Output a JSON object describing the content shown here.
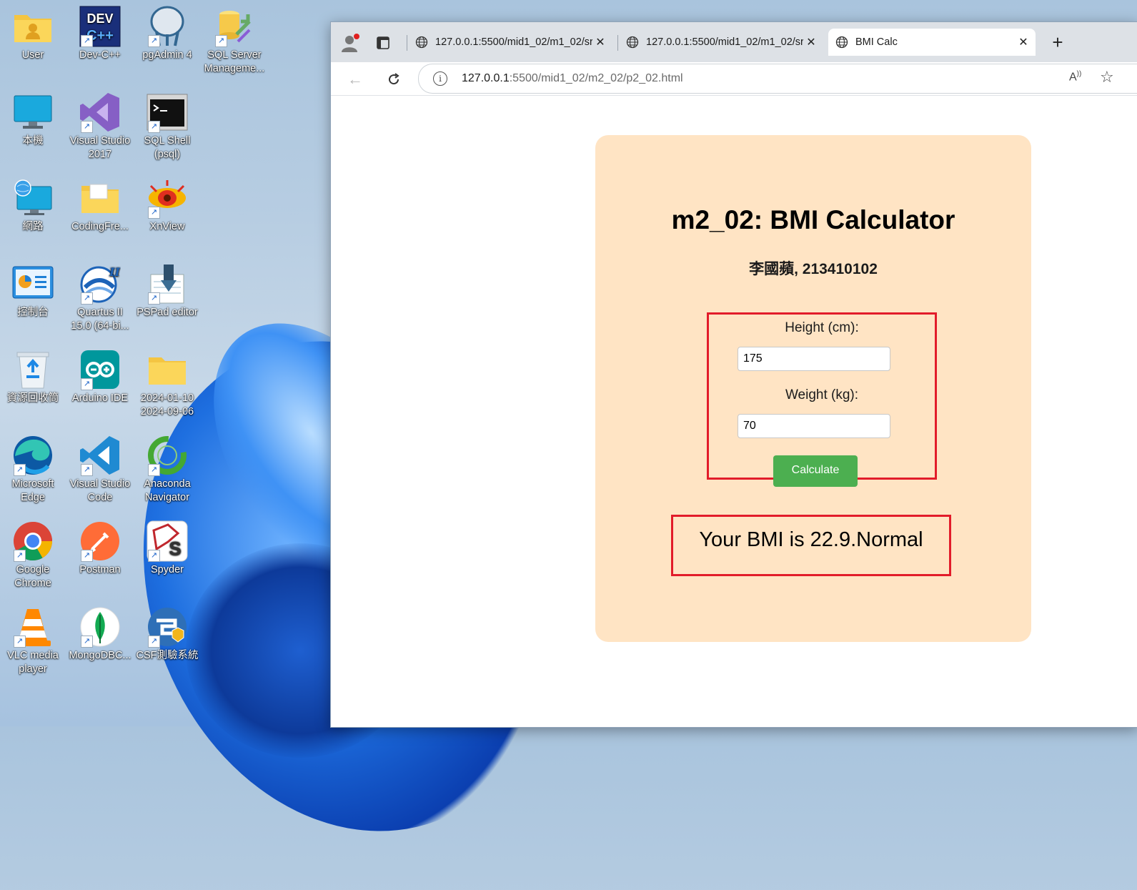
{
  "desktop": {
    "icons": [
      {
        "label": "User",
        "icon": "user-folder-icon"
      },
      {
        "label": "Dev-C++",
        "icon": "devcpp-icon"
      },
      {
        "label": "pgAdmin 4",
        "icon": "pgadmin-icon"
      },
      {
        "label": "SQL Server Manageme...",
        "icon": "sql-server-icon"
      },
      {
        "label": "本機",
        "icon": "monitor-icon"
      },
      {
        "label": "Visual Studio 2017",
        "icon": "visual-studio-icon"
      },
      {
        "label": "SQL Shell (psql)",
        "icon": "terminal-icon"
      },
      {
        "label": "網路",
        "icon": "network-icon"
      },
      {
        "label": "CodingFre...",
        "icon": "folder-icon"
      },
      {
        "label": "XnView",
        "icon": "xnview-icon"
      },
      {
        "label": "控制台",
        "icon": "control-panel-icon"
      },
      {
        "label": "Quartus II 15.0 (64-bi...",
        "icon": "quartus-icon"
      },
      {
        "label": "PSPad editor",
        "icon": "pspad-icon"
      },
      {
        "label": "資源回收筒",
        "icon": "recycle-bin-icon"
      },
      {
        "label": "Arduino IDE",
        "icon": "arduino-icon"
      },
      {
        "label": "2024-01-10 2024-09-06",
        "icon": "folder-icon"
      },
      {
        "label": "Microsoft Edge",
        "icon": "edge-icon"
      },
      {
        "label": "Visual Studio Code",
        "icon": "vscode-icon"
      },
      {
        "label": "Anaconda Navigator",
        "icon": "anaconda-icon"
      },
      {
        "label": "Google Chrome",
        "icon": "chrome-icon"
      },
      {
        "label": "Postman",
        "icon": "postman-icon"
      },
      {
        "label": "Spyder",
        "icon": "spyder-icon"
      },
      {
        "label": "VLC media player",
        "icon": "vlc-icon"
      },
      {
        "label": "MongoDBC...",
        "icon": "mongodb-icon"
      },
      {
        "label": "CSF測驗系統",
        "icon": "csf-icon"
      }
    ]
  },
  "browser": {
    "tabs": [
      {
        "title": "127.0.0.1:5500/mid1_02/m1_02/sr",
        "active": false
      },
      {
        "title": "127.0.0.1:5500/mid1_02/m1_02/sr",
        "active": false
      },
      {
        "title": "BMI Calc",
        "active": true
      }
    ],
    "url_host": "127.0.0.1",
    "url_path": ":5500/mid1_02/m2_02/p2_02.html",
    "read_aloud_label": "A)"
  },
  "page": {
    "title": "m2_02: BMI Calculator",
    "subtitle": "李國蘋, 213410102",
    "height_label": "Height (cm):",
    "height_value": "175",
    "weight_label": "Weight (kg):",
    "weight_value": "70",
    "calculate_label": "Calculate",
    "result_text": "Your BMI is 22.9.Normal"
  }
}
